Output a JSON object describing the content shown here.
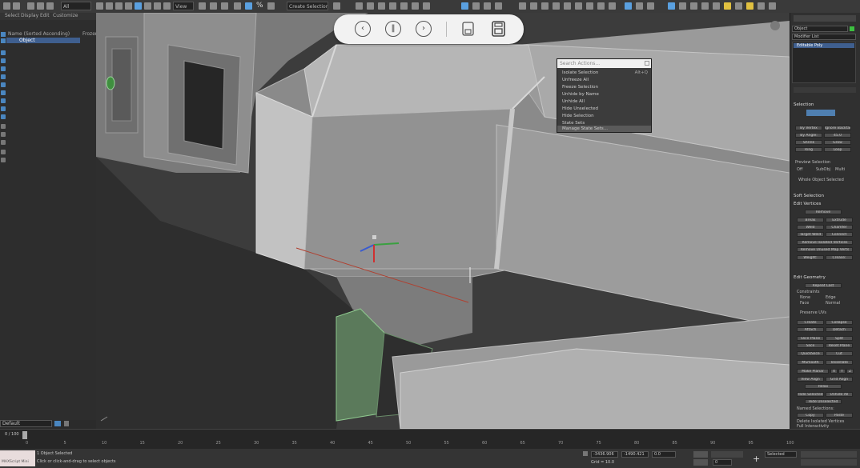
{
  "toolbar": {
    "selection_filter": "All",
    "view_dropdown": "View",
    "named_selection_placeholder": "Create Selection Se",
    "percent_snap_icon": "%"
  },
  "menu": {
    "items": [
      "Select",
      "Display",
      "Edit",
      "Customize"
    ]
  },
  "explorer": {
    "rows": [
      {
        "label": "Name (Sorted Ascending)",
        "note": "Frozen"
      },
      {
        "label": "Object"
      }
    ],
    "bottom_field": "Default"
  },
  "media_controls": {
    "prev_label": "‹",
    "pause_label": "‖",
    "next_label": "›"
  },
  "quad_menu": {
    "search_placeholder": "Search Actions...",
    "items": [
      {
        "label": "Isolate Selection",
        "shortcut": "Alt+Q"
      },
      {
        "label": "Unfreeze All",
        "shortcut": ""
      },
      {
        "label": "Freeze Selection",
        "shortcut": ""
      },
      {
        "label": "Unhide by Name",
        "shortcut": ""
      },
      {
        "label": "Unhide All",
        "shortcut": ""
      },
      {
        "label": "Hide Unselected",
        "shortcut": ""
      },
      {
        "label": "Hide Selection",
        "shortcut": ""
      },
      {
        "label": "State Sets",
        "shortcut": ""
      },
      {
        "label": "Manage State Sets...",
        "shortcut": ""
      }
    ]
  },
  "command_panel": {
    "object_name": "Object",
    "modifier_list": "Modifier List",
    "stack_item": "Editable Poly",
    "sections": {
      "selection": "Selection",
      "soft_selection": "Soft Selection",
      "edit_vertices": "Edit Vertices",
      "edit_geometry": "Edit Geometry"
    },
    "selection_buttons": [
      "By Vertex",
      "Ignore Backfacing",
      "By Angle:",
      "45.0"
    ],
    "grow_shrink": [
      "Shrink",
      "Grow",
      "Ring",
      "Loop"
    ],
    "preview_label": "Preview Selection",
    "preview_options": [
      "Off",
      "SubObj",
      "Multi"
    ],
    "whole_object": "Whole Object Selected",
    "edit_vertices_buttons": [
      "Remove",
      "Break",
      "Extrude",
      "Weld",
      "Chamfer",
      "Target Weld",
      "Connect",
      "Remove Isolated Vertices",
      "Remove Unused Map Verts",
      "Weight:",
      "Crease:"
    ],
    "edit_geometry_buttons": [
      "Repeat Last",
      "Constraints",
      "None",
      "Edge",
      "Face",
      "Normal",
      "Preserve UVs",
      "Create",
      "Collapse",
      "Attach",
      "Detach",
      "Slice Plane",
      "Split",
      "Slice",
      "Reset Plane",
      "QuickSlice",
      "Cut",
      "MSmooth",
      "Tessellate",
      "Make Planar",
      "X",
      "Y",
      "Z",
      "View Align",
      "Grid Align",
      "Relax",
      "Hide Selected",
      "Unhide All",
      "Hide Unselected",
      "Named Selections:",
      "Copy",
      "Paste",
      "Delete Isolated Vertices",
      "Full Interactivity"
    ]
  },
  "timeline": {
    "frame_display": "0 / 100",
    "ticks": [
      "0",
      "5",
      "10",
      "15",
      "20",
      "25",
      "30",
      "35",
      "40",
      "45",
      "50",
      "55",
      "60",
      "65",
      "70",
      "75",
      "80",
      "85",
      "90",
      "95",
      "100"
    ]
  },
  "status": {
    "script_label": "MAXScript Mini",
    "selection_text": "1 Object Selected",
    "prompt_text": "Click or click-and-drag to select objects",
    "x_value": "-3436.906",
    "y_value": "-1490.421",
    "z_value": "0.0",
    "grid_value": "Grid = 10.0",
    "key_mode": "Selected",
    "frame_field": "0"
  }
}
